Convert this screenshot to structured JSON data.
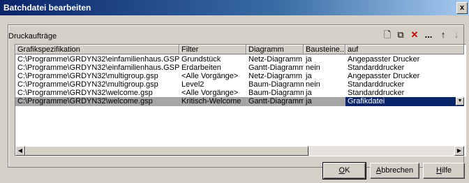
{
  "window": {
    "title": "Batchdatei bearbeiten",
    "close_glyph": "x"
  },
  "group": {
    "label": "Druckaufträge"
  },
  "toolbar": {
    "new_glyph": "🗋",
    "copy_glyph": "⧉",
    "delete_glyph": "✕",
    "more_glyph": "...",
    "up_glyph": "↑",
    "down_glyph": "↓"
  },
  "columns": [
    "Grafikspezifikation",
    "Filter",
    "Diagramm",
    "Bausteine...",
    "auf"
  ],
  "rows": [
    [
      "C:\\Programme\\GRDYN32\\einfamilienhaus.GSP",
      "Grundstück",
      "Netz-Diagramm",
      "ja",
      "Angepasster Drucker"
    ],
    [
      "C:\\Programme\\GRDYN32\\einfamilienhaus.GSP",
      "Erdarbeiten",
      "Gantt-Diagramm",
      "nein",
      "Standarddrucker"
    ],
    [
      "C:\\Programme\\GRDYN32\\multigroup.gsp",
      "<Alle Vorgänge>",
      "Netz-Diagramm",
      "ja",
      "Angepasster Drucker"
    ],
    [
      "C:\\Programme\\GRDYN32\\multigroup.gsp",
      "Level2",
      "Baum-Diagramm",
      "nein",
      "Standarddrucker"
    ],
    [
      "C:\\Programme\\GRDYN32\\welcome.gsp",
      "<Alle Vorgänge>",
      "Baum-Diagramm",
      "ja",
      "Standarddrucker"
    ],
    [
      "C:\\Programme\\GRDYN32\\welcome.gsp",
      "Kritisch-Welcome",
      "Gantt-Diagramm",
      "ja",
      "Grafikdatei"
    ]
  ],
  "selected_row": 5,
  "buttons": {
    "ok_first": "O",
    "ok_rest": "K",
    "cancel_first": "A",
    "cancel_rest": "bbrechen",
    "help_first": "H",
    "help_rest": "ilfe"
  }
}
